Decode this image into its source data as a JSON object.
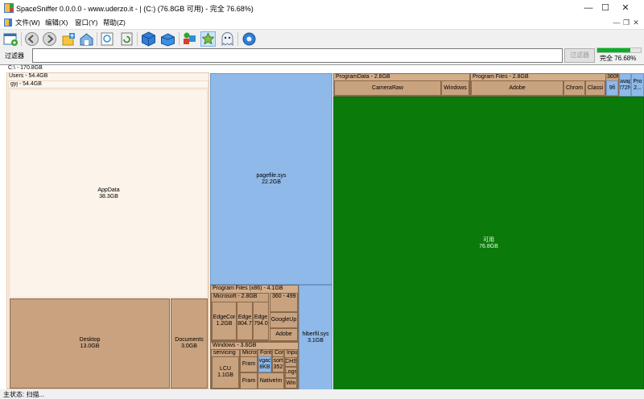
{
  "title_bar": {
    "title": "SpaceSniffer 0.0.0.0 - www.uderzo.it - | (C:) (76.8GB 可用) - 完全 76.68%)",
    "minimize_glyph": "—",
    "maximize_glyph": "☐",
    "close_glyph": "✕"
  },
  "menu": {
    "file": "文件(W)",
    "edit": "编辑(X)",
    "window": "窗口(Y)",
    "help": "帮助(Z)",
    "mdi_minimize": "—",
    "mdi_restore": "❐",
    "mdi_close": "✕"
  },
  "toolbar_icons": [
    "new-scan-icon",
    "back-icon",
    "forward-icon",
    "home-icon",
    "network-icon",
    "refresh-icon",
    "box-icon",
    "box-open-icon",
    "tag-filter-icon",
    "star-icon",
    "ghost-icon",
    "settings-gear-icon"
  ],
  "filter": {
    "label": "过滤器",
    "value": "",
    "button": "过滤器",
    "progress_percent": 76.68,
    "progress_text": "完全 76.68%"
  },
  "map": {
    "drive_header": "C:\\ - 170.8GB",
    "users_header": "Users - 54.4GB",
    "gyj_header": "gyj - 54.4GB",
    "appdata": {
      "name": "AppData",
      "size": "38.3GB"
    },
    "desktop": {
      "name": "Desktop",
      "size": "13.0GB"
    },
    "documents": {
      "name": "Documents",
      "size": "3.0GB"
    },
    "pagefile": {
      "name": "pagefile.sys",
      "size": "22.2GB"
    },
    "hiberfil": {
      "name": "hiberfil.sys",
      "size": "3.1GB"
    },
    "pf86": {
      "header": "Program Files (x86) - 4.1GB",
      "microsoft": "Microsoft - 2.8GB",
      "edgecore": {
        "name": "EdgeCor",
        "size": "1.2GB"
      },
      "edge": {
        "name": "Edge",
        "size": "804.7"
      },
      "edgeupdate": {
        "name": "Edge",
        "size": "794.0"
      },
      "threesixty": "360 - 499",
      "googleup": "GoogleUp",
      "adobe": "Adobe"
    },
    "windows": {
      "header": "Windows - 3.6GB",
      "servicing": "servicing",
      "lcu": {
        "name": "LCU",
        "size": "1.1GB"
      },
      "microsoft": "Micros",
      "fram1": "Fram",
      "fram2": "Fram",
      "fonts": "Fonts",
      "vgac": {
        "name": "vgac",
        "size": "8KB"
      },
      "native": "NativeIm",
      "cont": "Cont",
      "sort": {
        "name": "sort",
        "size": "352"
      },
      "inpu": "Inpu",
      "chs": "CHS",
      "logs": "Logs",
      "win": "Win"
    },
    "programdata": {
      "header": "ProgramData - 2.8GB",
      "cameraraw": "CameraRaw",
      "windows": "Windows"
    },
    "programfiles": {
      "header": "Program Files - 2.8GB",
      "adobe": "Adobe",
      "chrome": "Chrom",
      "classic": "Classi",
      "threesixty": "360F",
      "nine": "9fi"
    },
    "swap": {
      "name": "swap",
      "size": "272N"
    },
    "pro": {
      "name": "Pro",
      "size": "2..."
    },
    "free": {
      "name": "可用",
      "size": "76.8GB"
    }
  },
  "status": {
    "text": "主状态: 扫描..."
  },
  "colors": {
    "folder": "#c9a27f",
    "file": "#8fb9e8",
    "free": "#0a7a0a",
    "progress": "#06b025"
  }
}
